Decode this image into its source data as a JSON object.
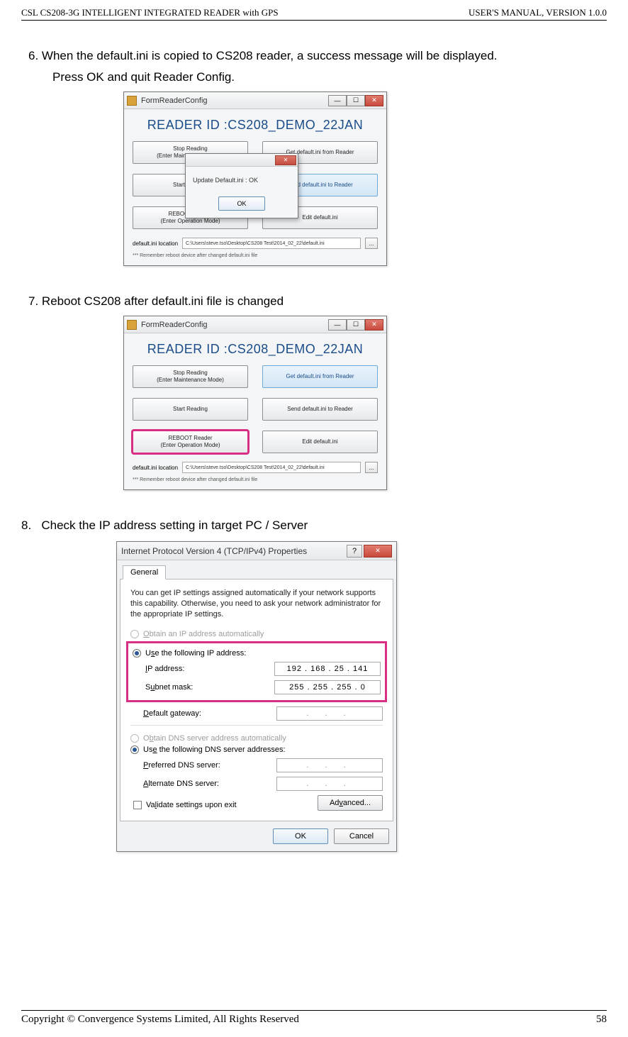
{
  "header": {
    "left": "CSL CS208-3G INTELLIGENT INTEGRATED READER with GPS",
    "right": "USER'S  MANUAL,  VERSION  1.0.0"
  },
  "footer": {
    "left": "Copyright © Convergence Systems Limited, All Rights Reserved",
    "right": "58"
  },
  "steps": {
    "s6": {
      "num": "6.",
      "text": "When the default.ini is copied to CS208 reader, a success message will be displayed.",
      "sub": "Press OK and quit Reader Config."
    },
    "s7": {
      "num": "7.",
      "text": "Reboot CS208 after default.ini file is changed"
    },
    "s8": {
      "num": "8.",
      "text": "Check the IP address setting in target PC / Server"
    }
  },
  "form1": {
    "title": "FormReaderConfig",
    "readerId": "READER ID :CS208_DEMO_22JAN",
    "buttons": {
      "stop_l1": "Stop Reading",
      "stop_l2": "(Enter Maintenance Mode)",
      "getini": "Get default.ini from Reader",
      "start": "Start Reading",
      "sendini": "Send default.ini to Reader",
      "reboot_l1": "REBOOT Reader",
      "reboot_l2": "(Enter Operation Mode)",
      "editini": "Edit default.ini"
    },
    "pathLabel": "default.ini location",
    "path": "C:\\Users\\steve.tso\\Desktop\\CS208 Test\\2014_02_22\\default.ini",
    "browse": "...",
    "note": "*** Remember reboot device after changed default.ini file",
    "dialog": {
      "msg": "Update Default.ini : OK",
      "ok": "OK",
      "close": "✕"
    }
  },
  "form2": {
    "title": "FormReaderConfig",
    "readerId": "READER ID :CS208_DEMO_22JAN",
    "buttons": {
      "stop_l1": "Stop Reading",
      "stop_l2": "(Enter Maintenance Mode)",
      "getini": "Get default.ini from Reader",
      "start": "Start Reading",
      "sendini": "Send default.ini to Reader",
      "reboot_l1": "REBOOT Reader",
      "reboot_l2": "(Enter Operation Mode)",
      "editini": "Edit default.ini"
    },
    "pathLabel": "default.ini location",
    "path": "C:\\Users\\steve.tso\\Desktop\\CS208 Test\\2014_02_22\\default.ini",
    "browse": "...",
    "note": "*** Remember reboot device after changed default.ini file"
  },
  "ipv4": {
    "title": "Internet Protocol Version 4 (TCP/IPv4) Properties",
    "help": "?",
    "close": "✕",
    "tab": "General",
    "desc": "You can get IP settings assigned automatically if your network supports this capability. Otherwise, you need to ask your network administrator for the appropriate IP settings.",
    "r_auto_ip": "Obtain an IP address automatically",
    "r_use_ip": "Use the following IP address:",
    "f_ip": "IP address:",
    "v_ip": "192 . 168 .  25   . 141",
    "f_mask": "Subnet mask:",
    "v_mask": "255 . 255 . 255 .  0",
    "f_gw": "Default gateway:",
    "v_gw": ".        .        .",
    "r_auto_dns": "Obtain DNS server address automatically",
    "r_use_dns": "Use the following DNS server addresses:",
    "f_pdns": "Preferred DNS server:",
    "v_pdns": ".        .        .",
    "f_adns": "Alternate DNS server:",
    "v_adns": ".        .        .",
    "validate": "Validate settings upon exit",
    "adv": "Advanced...",
    "ok": "OK",
    "cancel": "Cancel"
  },
  "win": {
    "min": "—",
    "max": "☐",
    "close": "✕"
  }
}
